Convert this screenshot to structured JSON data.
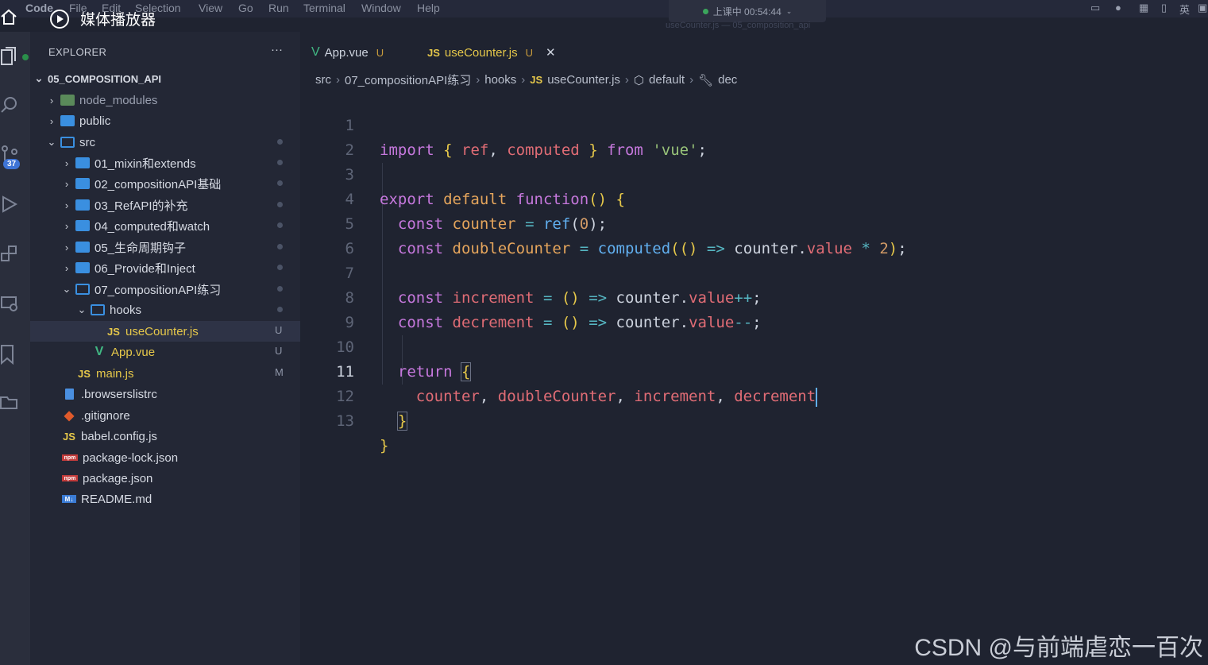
{
  "menubar": {
    "items": [
      "Code",
      "File",
      "Edit",
      "Selection",
      "View",
      "Go",
      "Run",
      "Terminal",
      "Window",
      "Help"
    ],
    "window_title": "useCounter.js — 05_composition_api",
    "status": "上课中 00:54:44",
    "tray_lang": "英"
  },
  "media": {
    "label": "媒体播放器"
  },
  "activity": {
    "scm_badge": "37"
  },
  "explorer": {
    "header": "EXPLORER",
    "more": "···",
    "root": "05_COMPOSITION_API",
    "items": [
      {
        "label": "node_modules",
        "mark": ""
      },
      {
        "label": "public",
        "mark": ""
      },
      {
        "label": "src",
        "mark": ""
      },
      {
        "label": "01_mixin和extends",
        "mark": ""
      },
      {
        "label": "02_compositionAPI基础",
        "mark": ""
      },
      {
        "label": "03_RefAPI的补充",
        "mark": ""
      },
      {
        "label": "04_computed和watch",
        "mark": ""
      },
      {
        "label": "05_生命周期钩子",
        "mark": ""
      },
      {
        "label": "06_Provide和Inject",
        "mark": ""
      },
      {
        "label": "07_compositionAPI练习",
        "mark": ""
      },
      {
        "label": "hooks",
        "mark": ""
      },
      {
        "label": "useCounter.js",
        "mark": "U"
      },
      {
        "label": "App.vue",
        "mark": "U"
      },
      {
        "label": "main.js",
        "mark": "M"
      },
      {
        "label": ".browserslistrc",
        "mark": ""
      },
      {
        "label": ".gitignore",
        "mark": ""
      },
      {
        "label": "babel.config.js",
        "mark": ""
      },
      {
        "label": "package-lock.json",
        "mark": ""
      },
      {
        "label": "package.json",
        "mark": ""
      },
      {
        "label": "README.md",
        "mark": ""
      }
    ]
  },
  "tabs": [
    {
      "label": "App.vue",
      "status": "U"
    },
    {
      "label": "useCounter.js",
      "status": "U",
      "close": "✕"
    }
  ],
  "breadcrumb": [
    "src",
    "07_compositionAPI练习",
    "hooks",
    "useCounter.js",
    "default",
    "dec"
  ],
  "code": {
    "line_numbers": [
      "1",
      "2",
      "3",
      "4",
      "5",
      "6",
      "7",
      "8",
      "9",
      "10",
      "11",
      "12",
      "13"
    ]
  },
  "watermark": "CSDN @与前端虐恋一百次",
  "colors": {
    "background": "#1f2330",
    "sidebar": "#232735",
    "accent": "#3a8fe0"
  }
}
